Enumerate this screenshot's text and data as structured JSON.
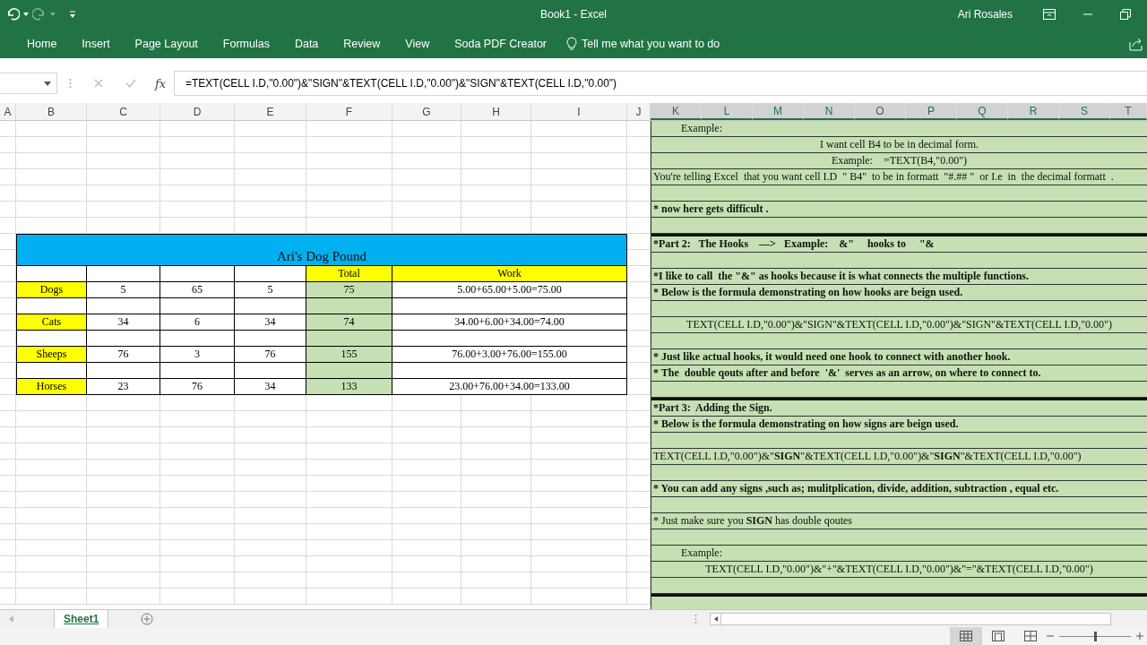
{
  "window": {
    "title": "Book1  -  Excel",
    "user": "Ari Rosales"
  },
  "ribbon": {
    "tabs": [
      "Home",
      "Insert",
      "Page Layout",
      "Formulas",
      "Data",
      "Review",
      "View",
      "Soda PDF Creator"
    ],
    "tell_me": "Tell me what you want to do"
  },
  "formula_bar": {
    "function_label": "fx",
    "formula": "=TEXT(CELL I.D,\"0.00\")&\"SIGN\"&TEXT(CELL I.D,\"0.00\")&\"SIGN\"&TEXT(CELL I.D,\"0.00\")"
  },
  "columns": [
    {
      "label": "A",
      "selected": false
    },
    {
      "label": "B",
      "selected": false
    },
    {
      "label": "C",
      "selected": false
    },
    {
      "label": "D",
      "selected": false
    },
    {
      "label": "E",
      "selected": false
    },
    {
      "label": "F",
      "selected": false
    },
    {
      "label": "G",
      "selected": false
    },
    {
      "label": "H",
      "selected": false
    },
    {
      "label": "I",
      "selected": false
    },
    {
      "label": "J",
      "selected": false
    },
    {
      "label": "K",
      "selected": true
    },
    {
      "label": "L",
      "selected": true
    },
    {
      "label": "M",
      "selected": true
    },
    {
      "label": "N",
      "selected": true
    },
    {
      "label": "O",
      "selected": true
    },
    {
      "label": "P",
      "selected": true
    },
    {
      "label": "Q",
      "selected": true
    },
    {
      "label": "R",
      "selected": true
    },
    {
      "label": "S",
      "selected": true
    },
    {
      "label": "T",
      "selected": true
    }
  ],
  "table": {
    "title": "Ari's Dog Pound",
    "total_heading": "Total",
    "work_heading": "Work",
    "rows": [
      {
        "label": "Dogs",
        "values": [
          "5",
          "65",
          "5"
        ],
        "total": "75",
        "work": "5.00+65.00+5.00=75.00"
      },
      {
        "label": "Cats",
        "values": [
          "34",
          "6",
          "34"
        ],
        "total": "74",
        "work": "34.00+6.00+34.00=74.00"
      },
      {
        "label": "Sheeps",
        "values": [
          "76",
          "3",
          "76"
        ],
        "total": "155",
        "work": "76.00+3.00+76.00=155.00"
      },
      {
        "label": "Horses",
        "values": [
          "23",
          "76",
          "34"
        ],
        "total": "133",
        "work": "23.00+76.00+34.00=133.00"
      }
    ]
  },
  "notes": [
    {
      "kind": "indented",
      "bold": false,
      "text": "Example:"
    },
    {
      "kind": "centered",
      "bold": false,
      "text": "I want cell B4 to be in decimal form."
    },
    {
      "kind": "centered",
      "bold": false,
      "text": "Example:    =TEXT(B4,\"0.00\")"
    },
    {
      "kind": "plain",
      "bold": false,
      "text": "You're telling Excel  that you want cell I.D  \" B4\"  to be in formatt  \"#.## \"  or I.e  in  the decimal formatt  ."
    },
    {
      "kind": "blank"
    },
    {
      "kind": "plain",
      "bold": true,
      "text": "* now here gets difficult ."
    },
    {
      "kind": "blank"
    },
    {
      "kind": "plain",
      "bold": true,
      "divider_above": true,
      "text": "*Part 2:   The Hooks    —>   Example:    &\"     hooks to     \"&"
    },
    {
      "kind": "blank"
    },
    {
      "kind": "plain",
      "bold": true,
      "text": "*I like to call  the \"&\" as hooks because it is what connects the multiple functions."
    },
    {
      "kind": "plain",
      "bold": true,
      "text": "* Below is the formula demonstrating on how hooks are beign used."
    },
    {
      "kind": "blank"
    },
    {
      "kind": "centered",
      "bold": false,
      "text": "TEXT(CELL I.D,\"0.00\")&\"SIGN\"&TEXT(CELL I.D,\"0.00\")&\"SIGN\"&TEXT(CELL I.D,\"0.00\")"
    },
    {
      "kind": "blank"
    },
    {
      "kind": "plain",
      "bold": true,
      "text": "* Just like actual hooks, it would need one hook to connect with another hook."
    },
    {
      "kind": "plain",
      "bold": true,
      "text": "* The  double qouts after and before  '&'  serves as an arrow, on where to connect to."
    },
    {
      "kind": "blank"
    },
    {
      "kind": "plain",
      "bold": true,
      "divider_above": true,
      "text": "*Part 3:  Adding the Sign."
    },
    {
      "kind": "plain",
      "bold": true,
      "text": "* Below is the formula demonstrating on how signs are beign used."
    },
    {
      "kind": "blank"
    },
    {
      "kind": "plain",
      "bold": false,
      "text": "TEXT(CELL I.D,\"0.00\")&\"**SIGN**\"&TEXT(CELL I.D,\"0.00\")&\"**SIGN**\"&TEXT(CELL I.D,\"0.00\")"
    },
    {
      "kind": "blank"
    },
    {
      "kind": "plain",
      "bold": true,
      "text": "* You can add any signs ,such as; mulitplication, divide, addition, subtraction , equal etc."
    },
    {
      "kind": "blank"
    },
    {
      "kind": "plain",
      "bold": false,
      "text": "* Just make sure you **SIGN** has double qoutes"
    },
    {
      "kind": "blank"
    },
    {
      "kind": "indented",
      "bold": false,
      "text": "Example:"
    },
    {
      "kind": "centered",
      "bold": false,
      "text": "TEXT(CELL I.D,\"0.00\")&\"+\"&TEXT(CELL I.D,\"0.00\")&\"=\"&TEXT(CELL I.D,\"0.00\")"
    },
    {
      "kind": "blank"
    },
    {
      "kind": "blank",
      "divider_above": true
    }
  ],
  "sheet_tabs": [
    {
      "label": "Sheet1",
      "selected": true
    }
  ],
  "zoom": {
    "level": 0.5
  }
}
